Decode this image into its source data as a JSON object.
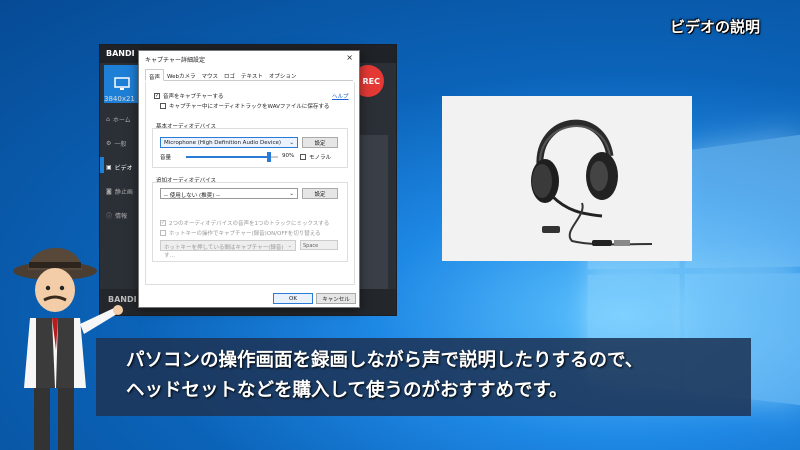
{
  "badge": "ビデオの説明",
  "bandicam": {
    "title": "BANDI",
    "rec": "REC",
    "resolution": "3840x21",
    "footer": "BANDI",
    "nav": [
      "ホーム",
      "一般",
      "ビデオ",
      "静止画",
      "情報"
    ]
  },
  "dialog": {
    "title": "キャプチャー詳細設定",
    "tabs": [
      "音声",
      "Webカメラ",
      "マウス",
      "ロゴ",
      "テキスト",
      "オプション"
    ],
    "capture_audio": "音声をキャプチャーする",
    "save_wav": "キャプチャー中にオーディオトラックをWAVファイルに保存する",
    "help": "ヘルプ",
    "basic_device_label": "基本オーディオデバイス",
    "basic_device_value": "Microphone (High Definition Audio Device)",
    "settings_label": "設定",
    "volume_label": "音量",
    "volume_value": "90%",
    "volume_fraction": 0.9,
    "mono_label": "モノラル",
    "extra_device_label": "追加オーディオデバイス",
    "extra_device_value": "-- 使用しない (推奨) --",
    "mix_label": "2つのオーディオデバイスの音声を1つのトラックにミックスする",
    "hotkey_label": "ホットキーの操作でキャプチャー(録音)ON/OFFを切り替える",
    "hotkey_select": "ホットキーを押している間はキャプチャー(録音)す…",
    "hotkey_key": "Space",
    "ok": "OK",
    "cancel": "キャンセル"
  },
  "caption": {
    "line1": "パソコンの操作画面を録画しながら声で説明したりするので、",
    "line2": "ヘッドセットなどを購入して使うのがおすすめです。"
  }
}
